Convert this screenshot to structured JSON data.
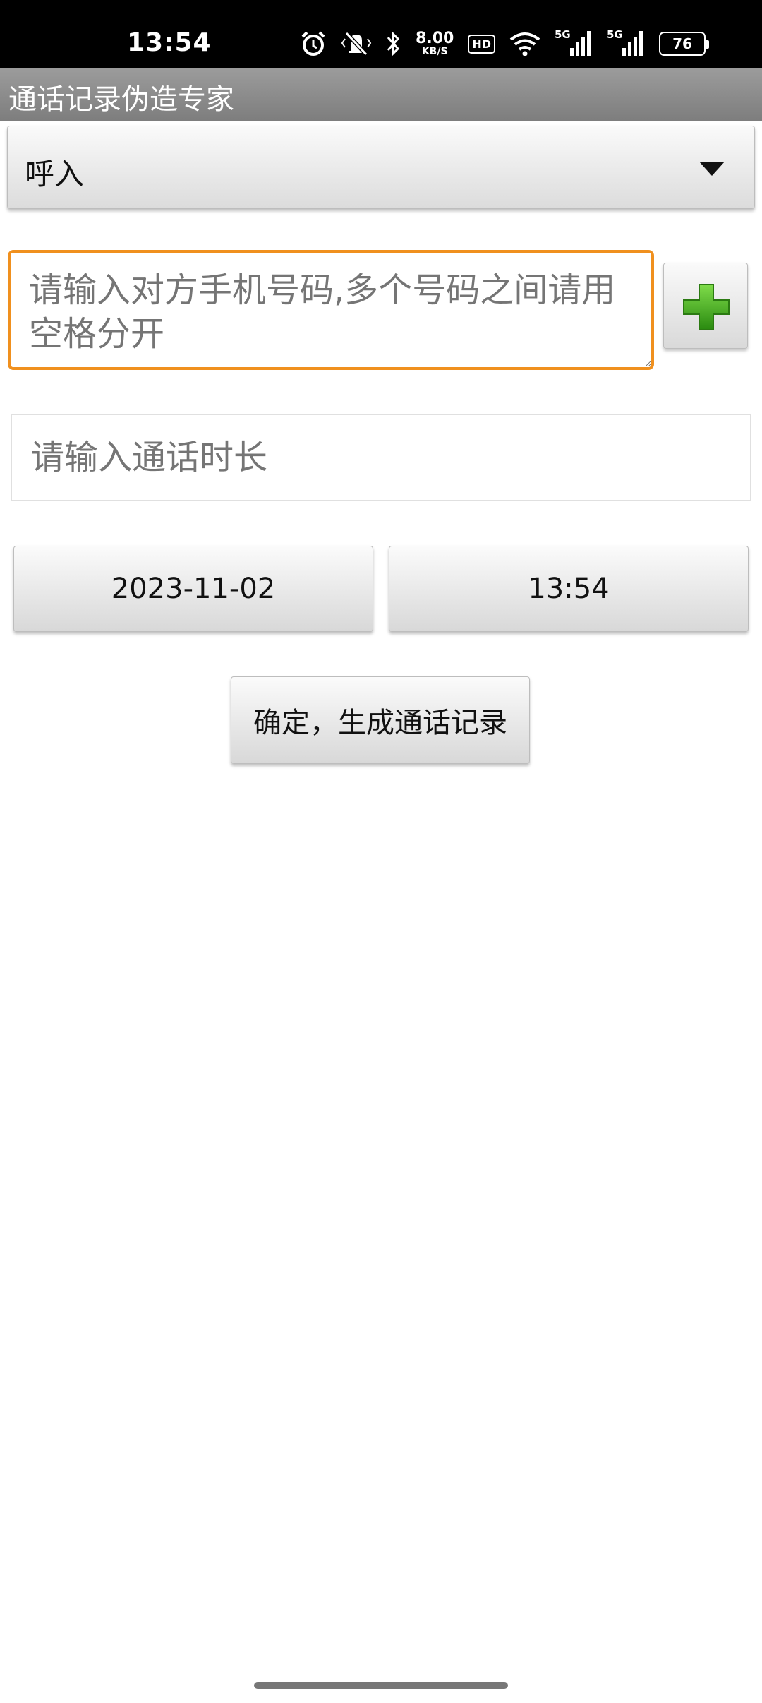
{
  "status_bar": {
    "time": "13:54",
    "net_speed_value": "8.00",
    "net_speed_unit": "KB/S",
    "hd_badge": "HD",
    "signal1_tag": "5G",
    "signal2_tag": "5G",
    "battery_level": "76"
  },
  "app": {
    "title": "通话记录伪造专家"
  },
  "form": {
    "call_type": {
      "selected": "呼入"
    },
    "phone_input": {
      "placeholder": "请输入对方手机号码,多个号码之间请用空格分开",
      "value": ""
    },
    "duration_input": {
      "placeholder": "请输入通话时长",
      "value": ""
    },
    "date_button_label": "2023-11-02",
    "time_button_label": "13:54",
    "confirm_button_label": "确定，生成通话记录"
  },
  "colors": {
    "focus_border": "#f0901e",
    "title_bar": "#8a8a8a",
    "plus_green": "#3aa31a"
  }
}
